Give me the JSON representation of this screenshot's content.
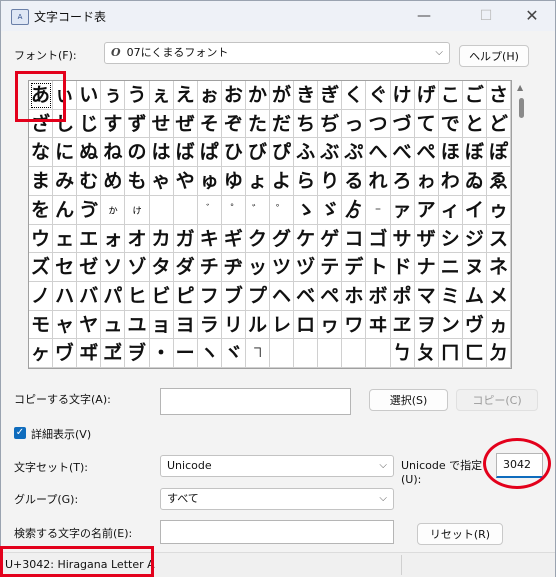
{
  "window": {
    "title": "文字コード表",
    "app_icon_text": "A",
    "min_glyph": "—",
    "max_glyph": "☐",
    "close_glyph": "✕"
  },
  "font_label": "フォント(F):",
  "font_select": {
    "glyph": "O",
    "value": "07にくまるフォント"
  },
  "help_button": "ヘルプ(H)",
  "char_grid": {
    "rows": [
      [
        "あ",
        "ぃ",
        "い",
        "ぅ",
        "う",
        "ぇ",
        "え",
        "ぉ",
        "お",
        "か",
        "が",
        "き",
        "ぎ",
        "く",
        "ぐ",
        "け",
        "げ",
        "こ",
        "ご",
        "さ"
      ],
      [
        "ざ",
        "し",
        "じ",
        "す",
        "ず",
        "せ",
        "ぜ",
        "そ",
        "ぞ",
        "た",
        "だ",
        "ち",
        "ぢ",
        "っ",
        "つ",
        "づ",
        "て",
        "で",
        "と",
        "ど"
      ],
      [
        "な",
        "に",
        "ぬ",
        "ね",
        "の",
        "は",
        "ば",
        "ぱ",
        "ひ",
        "び",
        "ぴ",
        "ふ",
        "ぶ",
        "ぷ",
        "へ",
        "べ",
        "ぺ",
        "ほ",
        "ぼ",
        "ぽ"
      ],
      [
        "ま",
        "み",
        "む",
        "め",
        "も",
        "ゃ",
        "や",
        "ゅ",
        "ゆ",
        "ょ",
        "よ",
        "ら",
        "り",
        "る",
        "れ",
        "ろ",
        "ゎ",
        "わ",
        "ゐ",
        "ゑ"
      ],
      [
        "を",
        "ん",
        "ゔ",
        "ゕ",
        "ゖ",
        "",
        "",
        "゙",
        "゚",
        "゛",
        "゜",
        "ゝ",
        "ゞ",
        "ゟ",
        "゠",
        "ァ",
        "ア",
        "ィ",
        "イ",
        "ゥ"
      ],
      [
        "ウ",
        "ェ",
        "エ",
        "ォ",
        "オ",
        "カ",
        "ガ",
        "キ",
        "ギ",
        "ク",
        "グ",
        "ケ",
        "ゲ",
        "コ",
        "ゴ",
        "サ",
        "ザ",
        "シ",
        "ジ",
        "ス"
      ],
      [
        "ズ",
        "セ",
        "ゼ",
        "ソ",
        "ゾ",
        "タ",
        "ダ",
        "チ",
        "ヂ",
        "ッ",
        "ツ",
        "ヅ",
        "テ",
        "デ",
        "ト",
        "ド",
        "ナ",
        "ニ",
        "ヌ",
        "ネ"
      ],
      [
        "ノ",
        "ハ",
        "バ",
        "パ",
        "ヒ",
        "ビ",
        "ピ",
        "フ",
        "ブ",
        "プ",
        "ヘ",
        "ベ",
        "ペ",
        "ホ",
        "ボ",
        "ポ",
        "マ",
        "ミ",
        "ム",
        "メ"
      ],
      [
        "モ",
        "ャ",
        "ヤ",
        "ュ",
        "ユ",
        "ョ",
        "ヨ",
        "ラ",
        "リ",
        "ル",
        "レ",
        "ロ",
        "ヮ",
        "ワ",
        "ヰ",
        "ヱ",
        "ヲ",
        "ン",
        "ヴ",
        "ヵ"
      ],
      [
        "ヶ",
        "ヷ",
        "ヸ",
        "ヹ",
        "ヺ",
        "・",
        "ー",
        "ヽ",
        "ヾ",
        "ヿ",
        "",
        "",
        "",
        "",
        "",
        "ㄅ",
        "ㄆ",
        "ㄇ",
        "ㄈ",
        "ㄉ"
      ]
    ],
    "selected": "あ"
  },
  "copy_label": "コピーする文字(A):",
  "copy_value": "",
  "select_button": "選択(S)",
  "copy_button": "コピー(C)",
  "advanced_check": {
    "label": "詳細表示(V)",
    "checked": true,
    "mark": "✓"
  },
  "charset_label": "文字セット(T):",
  "charset_value": "Unicode",
  "unicode_label_1": "Unicode で指定",
  "unicode_label_2": "(U):",
  "unicode_value": "3042",
  "group_label": "グループ(G):",
  "group_value": "すべて",
  "search_label": "検索する文字の名前(E):",
  "search_value": "",
  "reset_button": "リセット(R)",
  "status_text": "U+3042: Hiragana Letter A",
  "highlight_color": "#e3001b",
  "accent_color": "#0f6cbd"
}
